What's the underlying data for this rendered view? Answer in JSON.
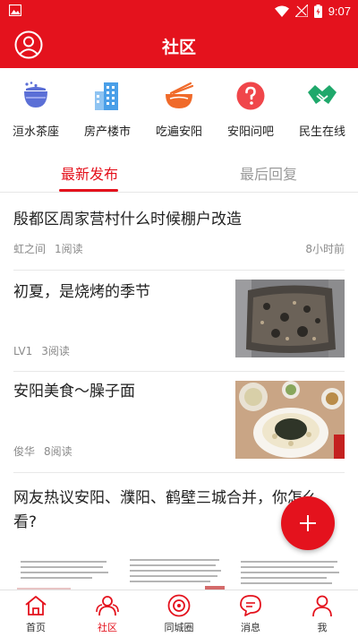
{
  "status_bar": {
    "time": "9:07"
  },
  "header": {
    "title": "社区"
  },
  "categories": [
    {
      "label": "洹水茶座",
      "icon": "teapot-icon",
      "color": "#5b6fd6"
    },
    {
      "label": "房产楼市",
      "icon": "buildings-icon",
      "color": "#4a9fe8"
    },
    {
      "label": "吃遍安阳",
      "icon": "noodle-bowl-icon",
      "color": "#f06a2a"
    },
    {
      "label": "安阳问吧",
      "icon": "question-icon",
      "color": "#f0464a"
    },
    {
      "label": "民生在线",
      "icon": "handshake-icon",
      "color": "#1fa86b"
    }
  ],
  "tabs": {
    "latest": "最新发布",
    "last_reply": "最后回复"
  },
  "posts": [
    {
      "title": "殷都区周家营村什么时候棚户改造",
      "author": "虹之间",
      "reads": "1阅读",
      "time": "8小时前"
    },
    {
      "title": "初夏，是烧烤的季节",
      "author": "LV1",
      "reads": "3阅读"
    },
    {
      "title": "安阳美食～臊子面",
      "author": "俊华",
      "reads": "8阅读"
    },
    {
      "title_line1": "网友热议安阳、濮阳、鹤壁三城合并，你怎么",
      "title_line2": "看?"
    }
  ],
  "bottom_nav": [
    {
      "label": "首页",
      "icon": "home-icon"
    },
    {
      "label": "社区",
      "icon": "community-icon"
    },
    {
      "label": "同城圈",
      "icon": "city-circle-icon"
    },
    {
      "label": "消息",
      "icon": "message-icon"
    },
    {
      "label": "我",
      "icon": "profile-icon"
    }
  ],
  "colors": {
    "brand": "#e4121d"
  }
}
